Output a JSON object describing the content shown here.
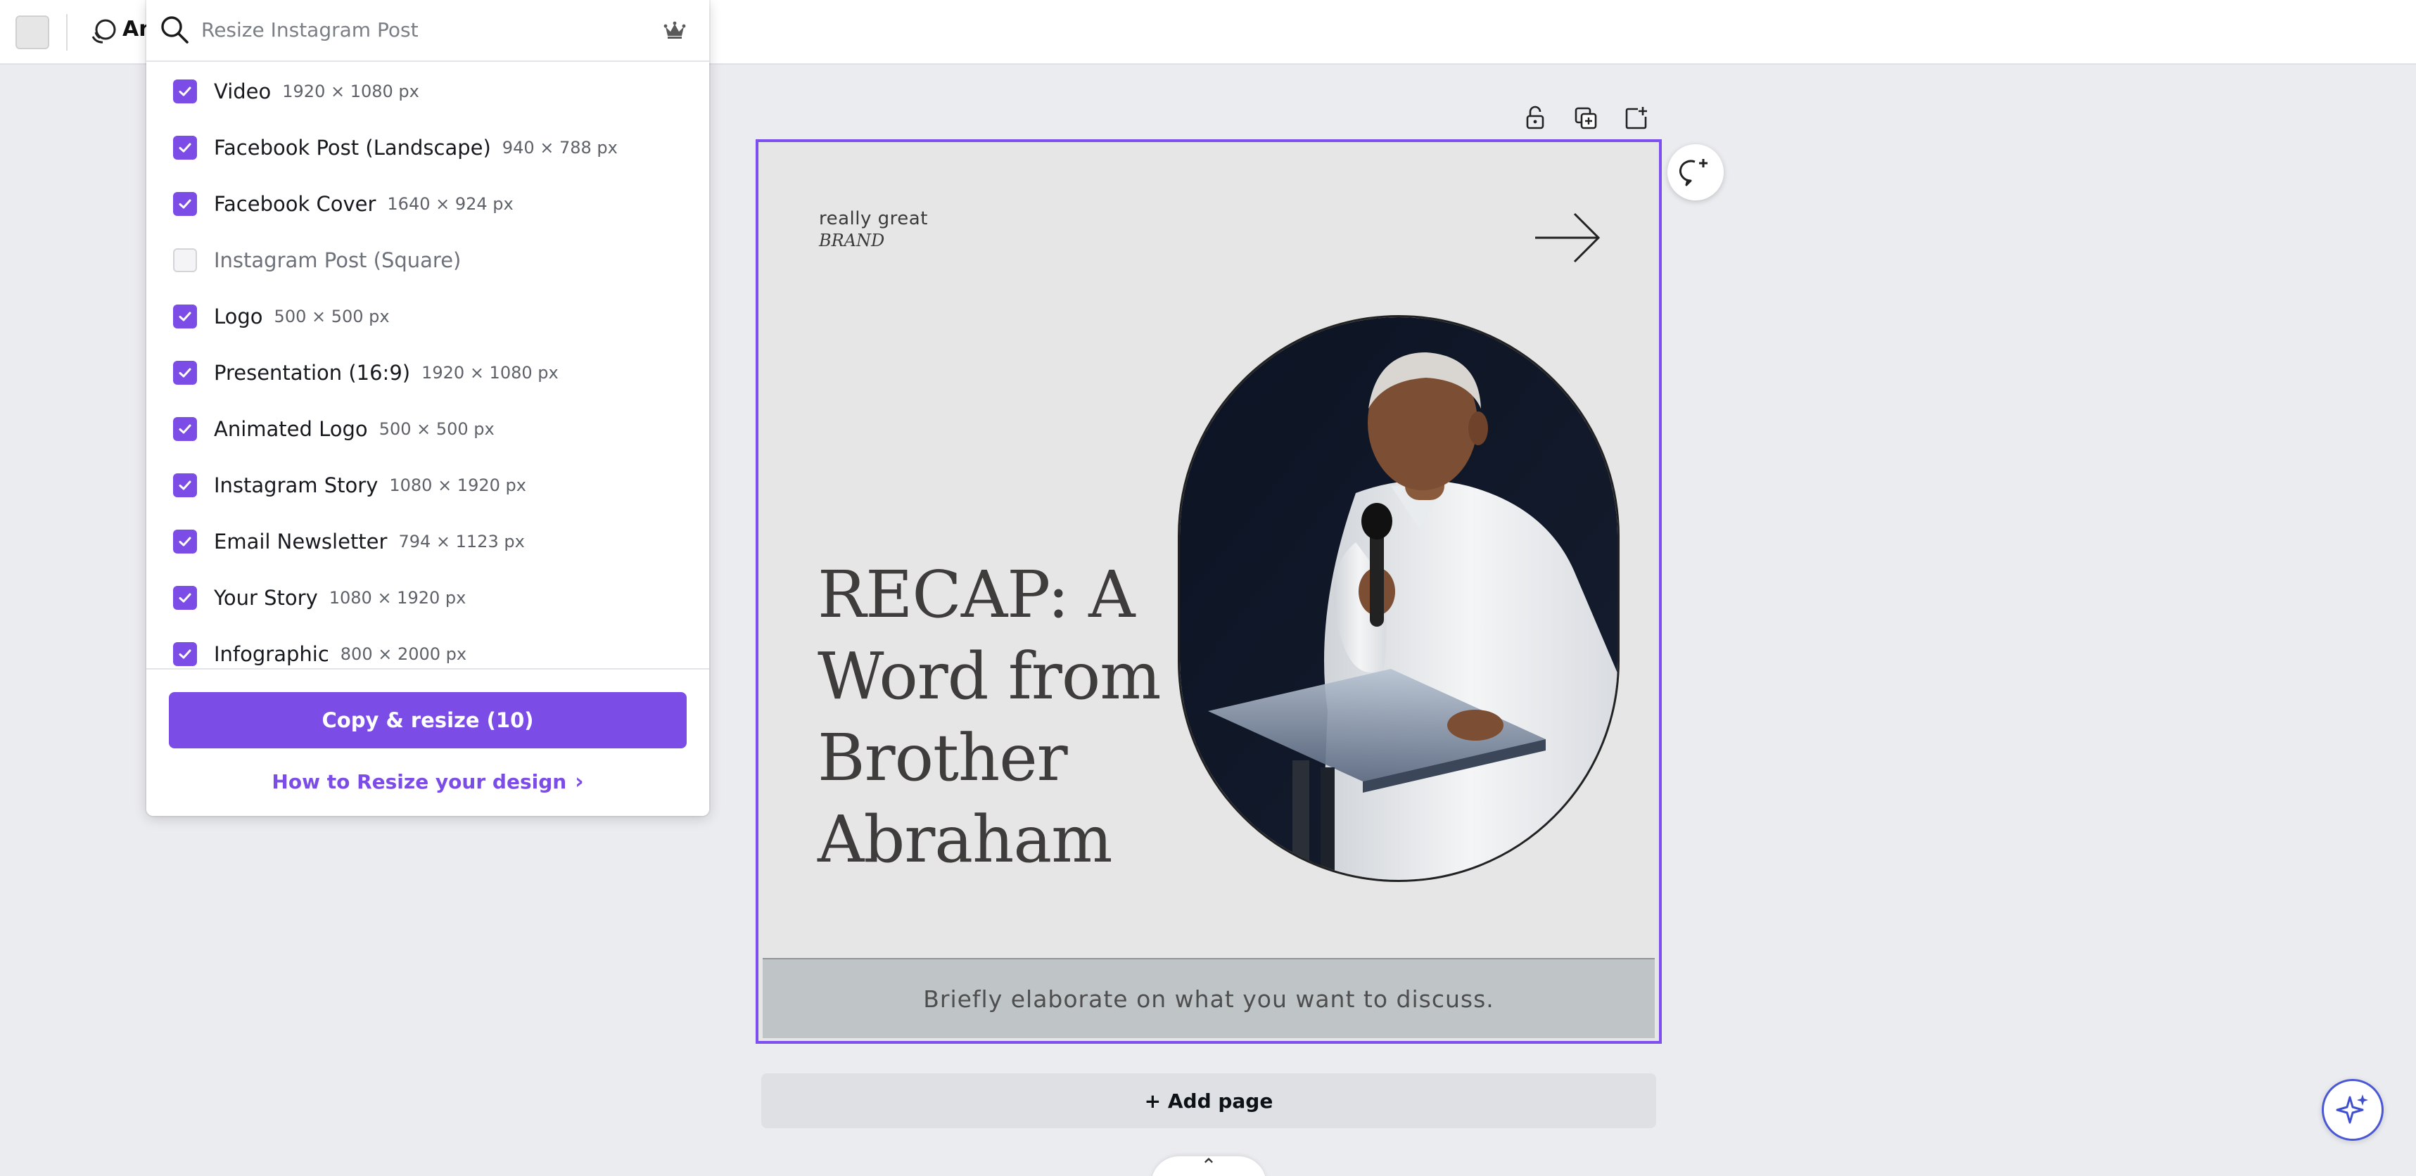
{
  "topbar": {
    "animate_label": "An"
  },
  "resize_panel": {
    "search_placeholder": "Resize Instagram Post",
    "options": [
      {
        "label": "Video",
        "size": "1920 × 1080 px",
        "checked": true
      },
      {
        "label": "Facebook Post (Landscape)",
        "size": "940 × 788 px",
        "checked": true
      },
      {
        "label": "Facebook Cover",
        "size": "1640 × 924 px",
        "checked": true
      },
      {
        "label": "Instagram Post (Square)",
        "size": "",
        "checked": false
      },
      {
        "label": "Logo",
        "size": "500 × 500 px",
        "checked": true
      },
      {
        "label": "Presentation (16:9)",
        "size": "1920 × 1080 px",
        "checked": true
      },
      {
        "label": "Animated Logo",
        "size": "500 × 500 px",
        "checked": true
      },
      {
        "label": "Instagram Story",
        "size": "1080 × 1920 px",
        "checked": true
      },
      {
        "label": "Email Newsletter",
        "size": "794 × 1123 px",
        "checked": true
      },
      {
        "label": "Your Story",
        "size": "1080 × 1920 px",
        "checked": true
      },
      {
        "label": "Infographic",
        "size": "800 × 2000 px",
        "checked": true
      }
    ],
    "copy_button": "Copy & resize (10)",
    "howto_link": "How to Resize your design",
    "howto_chevron": "›"
  },
  "design": {
    "brand_line1": "really great",
    "brand_line2": "BRAND",
    "headline_lines": [
      "RECAP: A",
      "Word from",
      "Brother",
      "Abraham"
    ],
    "caption": "Briefly elaborate on what you want to discuss."
  },
  "canvas": {
    "add_page": "+ Add page",
    "collapse_glyph": "⌃"
  },
  "colors": {
    "accent": "#7b4de6",
    "page_border": "#7d4ff0",
    "caption_bar": "#bfc5c7",
    "canvas_bg": "#ebecf0"
  }
}
